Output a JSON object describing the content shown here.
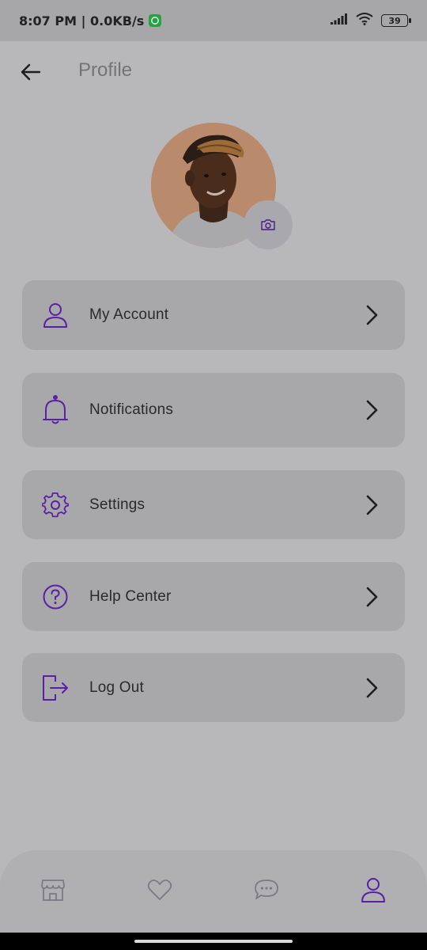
{
  "status_bar": {
    "time_text": "8:07 PM | 0.0KB/s",
    "battery": "39",
    "icons": [
      "whatsapp-icon",
      "signal-icon",
      "wifi-icon",
      "battery-icon"
    ]
  },
  "header": {
    "title": "Profile",
    "back_icon": "arrow-left-icon"
  },
  "avatar": {
    "camera_icon": "camera-icon"
  },
  "menu": {
    "items": [
      {
        "label": "My Account",
        "icon": "user-icon"
      },
      {
        "label": "Notifications",
        "icon": "bell-icon"
      },
      {
        "label": "Settings",
        "icon": "gear-icon"
      },
      {
        "label": "Help Center",
        "icon": "help-icon"
      },
      {
        "label": "Log Out",
        "icon": "logout-icon"
      }
    ]
  },
  "bottom_nav": {
    "items": [
      {
        "icon": "store-icon",
        "active": false
      },
      {
        "icon": "heart-icon",
        "active": false
      },
      {
        "icon": "chat-icon",
        "active": false
      },
      {
        "icon": "user-icon",
        "active": true
      }
    ]
  },
  "colors": {
    "accent": "#5b1fa6",
    "inactive_icon": "#7a7a80",
    "card_bg": "#a8a8ab",
    "page_bg": "#b8b8bb"
  }
}
